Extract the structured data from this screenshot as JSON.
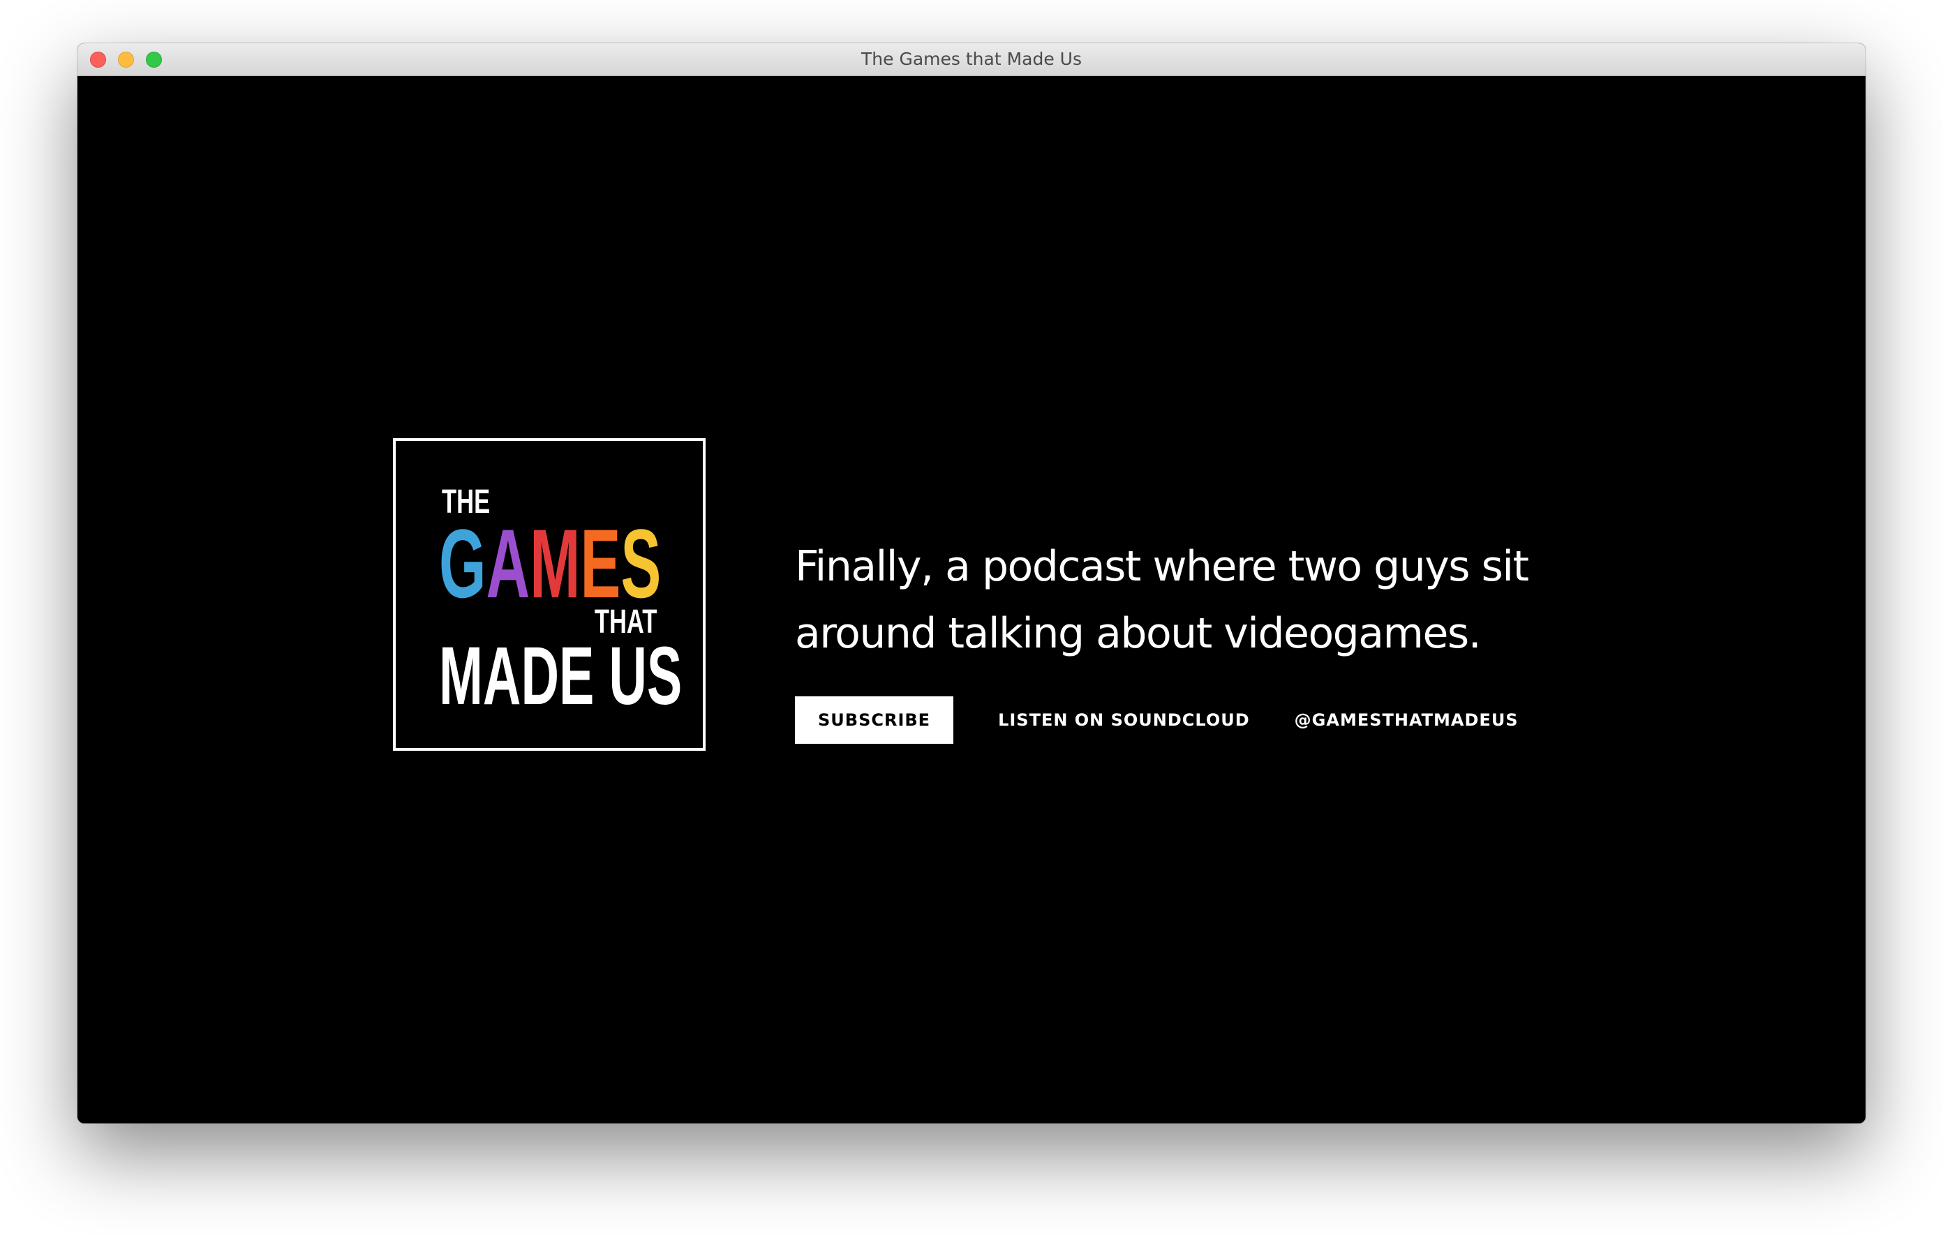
{
  "window": {
    "title": "The Games that Made Us"
  },
  "logo": {
    "line_the": "THE",
    "games_letters": [
      {
        "char": "G",
        "color": "#3fa3db"
      },
      {
        "char": "A",
        "color": "#9b4fcf"
      },
      {
        "char": "M",
        "color": "#e23a3a"
      },
      {
        "char": "E",
        "color": "#f56a21"
      },
      {
        "char": "S",
        "color": "#f7c331"
      }
    ],
    "line_that": "THAT",
    "line_made_us": "MADE US"
  },
  "hero": {
    "tagline": "Finally, a podcast where two guys sit around talking about videogames."
  },
  "actions": {
    "subscribe_label": "SUBSCRIBE",
    "soundcloud_label": "LISTEN ON SOUNDCLOUD",
    "twitter_label": "@GAMESTHATMADEUS"
  },
  "colors": {
    "background": "#000000",
    "text": "#ffffff"
  }
}
